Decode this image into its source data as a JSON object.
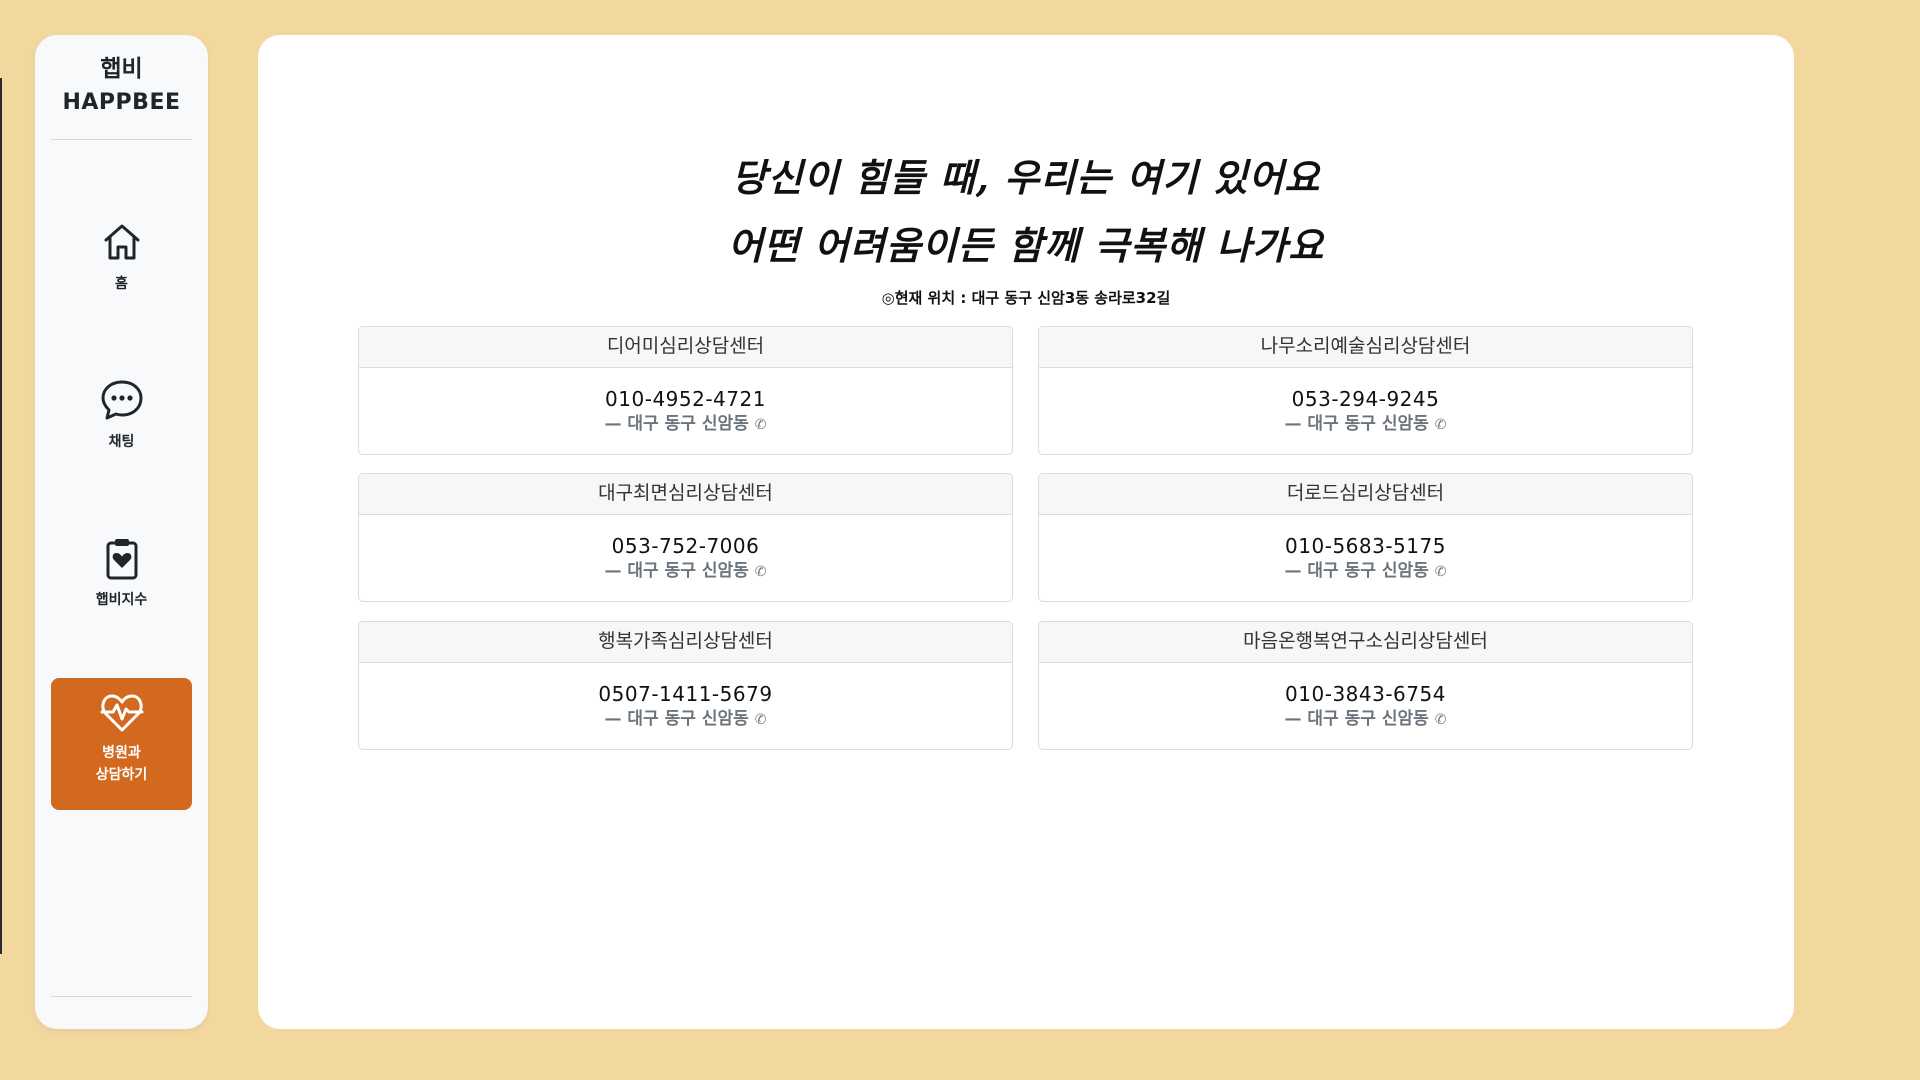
{
  "brand": {
    "name_ko": "햅비",
    "name_en": "HAPPBEE"
  },
  "nav": {
    "home_label": "홈",
    "chat_label": "채팅",
    "index_label": "햅비지수",
    "counsel_label": "병원과\n상담하기",
    "active_color": "#d2691e"
  },
  "main": {
    "headline_1": "당신이 힘들 때, 우리는 여기 있어요",
    "headline_2": "어떤 어려움이든 함께 극복해 나가요",
    "location": "◎현재 위치 : 대구 동구 신암3동 송라로32길"
  },
  "centers": [
    {
      "name": "디어미심리상담센터",
      "phone": "010-4952-4721",
      "address": "— 대구 동구 신암동"
    },
    {
      "name": "나무소리예술심리상담센터",
      "phone": "053-294-9245",
      "address": "— 대구 동구 신암동"
    },
    {
      "name": "대구최면심리상담센터",
      "phone": "053-752-7006",
      "address": "— 대구 동구 신암동"
    },
    {
      "name": "더로드심리상담센터",
      "phone": "010-5683-5175",
      "address": "— 대구 동구 신암동"
    },
    {
      "name": "행복가족심리상담센터",
      "phone": "0507-1411-5679",
      "address": "— 대구 동구 신암동"
    },
    {
      "name": "마음온행복연구소심리상담센터",
      "phone": "010-3843-6754",
      "address": "— 대구 동구 신암동"
    }
  ],
  "colors": {
    "background": "#f2d89e",
    "accent": "#d2691e"
  }
}
